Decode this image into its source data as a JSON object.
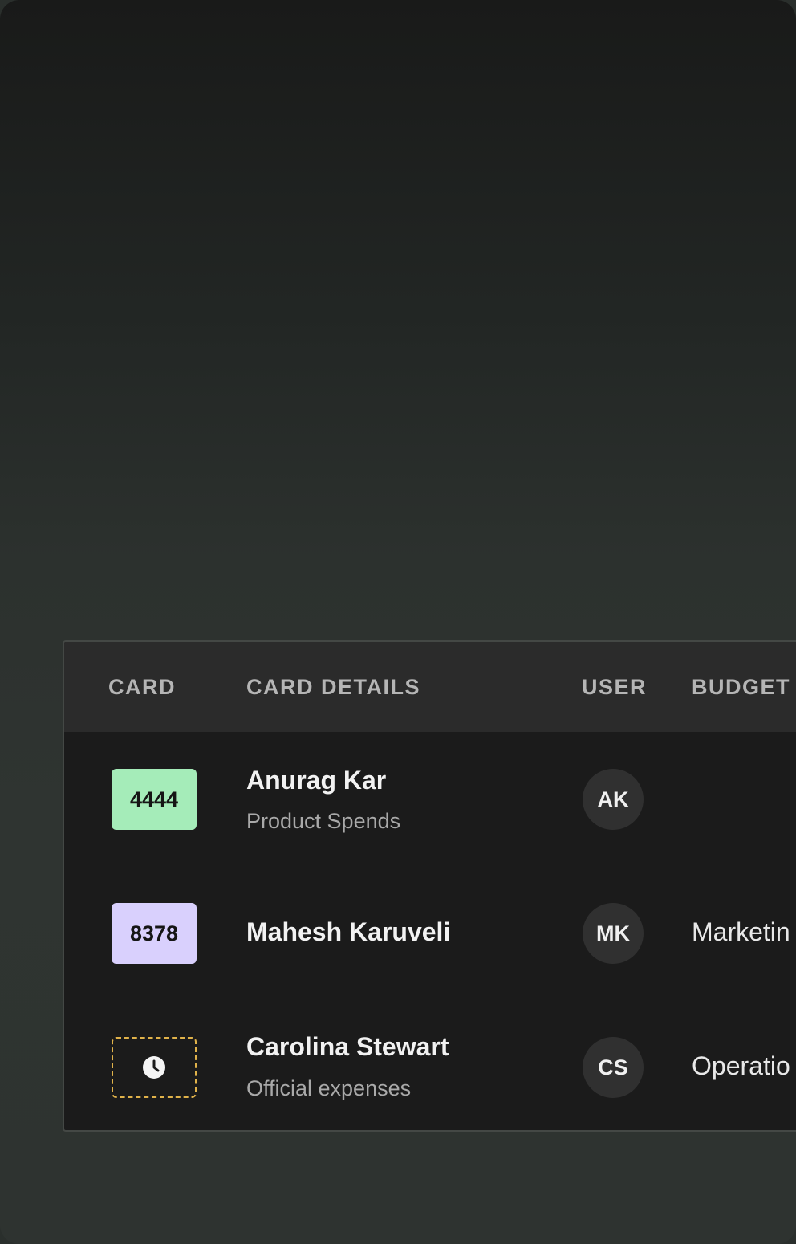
{
  "table": {
    "columns": [
      "CARD",
      "CARD DETAILS",
      "USER",
      "BUDGET"
    ],
    "rows": [
      {
        "card": "4444",
        "name": "Anurag Kar",
        "detail": "Product Spends",
        "initials": "AK",
        "budget": ""
      },
      {
        "card": "8378",
        "name": "Mahesh Karuveli",
        "detail": "",
        "initials": "MK",
        "budget": "Marketin"
      },
      {
        "card": "",
        "card_icon": "clock-icon",
        "name": "Carolina Stewart",
        "detail": "Official expenses",
        "initials": "CS",
        "budget": "Operatio"
      }
    ]
  },
  "colors": {
    "chip_green": "#a5ecb9",
    "chip_purple": "#d9d0fd",
    "pending_border": "#e0b24a"
  }
}
